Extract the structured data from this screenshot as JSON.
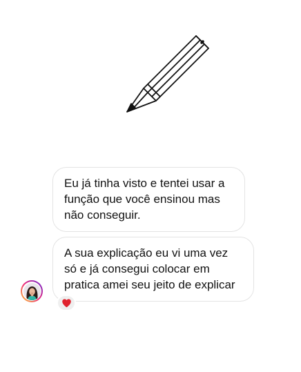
{
  "illustration": {
    "icon": "pencil-icon"
  },
  "messages": [
    {
      "lines": [
        "Eu já tinha visto e tentei usar a",
        "função que você ensinou mas",
        "não conseguir."
      ]
    },
    {
      "lines": [
        "A sua explicação eu vi uma vez",
        "só e já consegui colocar em",
        "pratica amei seu jeito de explicar"
      ]
    }
  ],
  "sender": {
    "avatar": "profile-avatar"
  },
  "reaction": {
    "icon": "heart-icon",
    "color": "#e0222e"
  },
  "colors": {
    "bubble_border": "#e3e3e3",
    "text": "#111111",
    "reaction_background": "#efefef"
  }
}
